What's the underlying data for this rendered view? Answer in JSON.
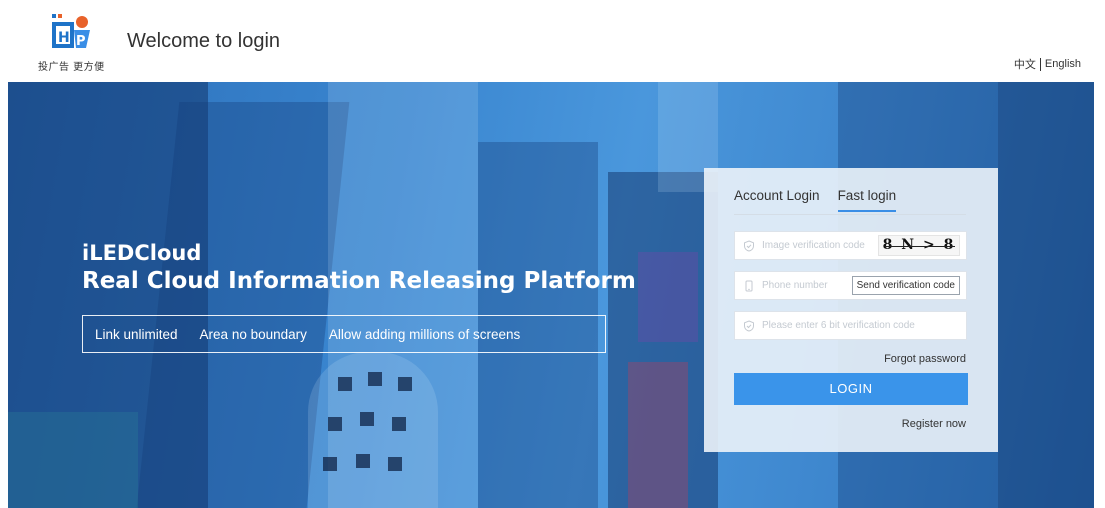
{
  "header": {
    "logo_tagline": "投广告 更方便",
    "welcome": "Welcome to login",
    "languages": [
      "中文",
      "English"
    ]
  },
  "hero": {
    "brand_name": "iLEDCloud",
    "platform_title": "Real Cloud Information Releasing Platform",
    "features": [
      "Link unlimited",
      "Area no boundary",
      "Allow adding millions of screens"
    ]
  },
  "login": {
    "tabs": [
      {
        "label": "Account Login",
        "active": false
      },
      {
        "label": "Fast login",
        "active": true
      }
    ],
    "image_code_placeholder": "Image verification code",
    "captcha_text": "8 N > 8",
    "phone_placeholder": "Phone number",
    "send_code_label": "Send verification code",
    "sms_code_placeholder": "Please enter 6 bit verification code",
    "forgot_label": "Forgot password",
    "login_label": "LOGIN",
    "register_label": "Register now"
  },
  "colors": {
    "accent": "#3a94ea",
    "hero_blue": "#3a86d0"
  }
}
